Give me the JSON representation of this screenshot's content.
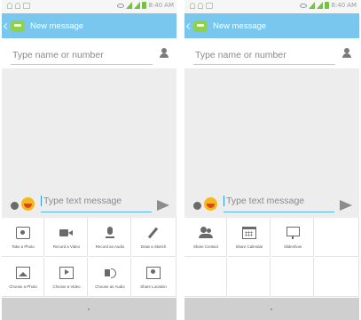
{
  "screens": [
    {
      "status": {
        "time": "8:40",
        "ampm": "AM"
      },
      "action_bar": {
        "title": "New message"
      },
      "recipient": {
        "placeholder": "Type name or number"
      },
      "compose": {
        "placeholder": "Type text message"
      },
      "attachments": [
        {
          "label": "Take a Photo",
          "icon": "camera-icon"
        },
        {
          "label": "Record a Video",
          "icon": "video-camera-icon"
        },
        {
          "label": "Record an Audio",
          "icon": "microphone-icon"
        },
        {
          "label": "Draw a Sketch",
          "icon": "pencil-icon"
        },
        {
          "label": "Choose a Photo",
          "icon": "image-icon"
        },
        {
          "label": "Choose a Video",
          "icon": "play-icon"
        },
        {
          "label": "Choose an Audio",
          "icon": "speaker-icon"
        },
        {
          "label": "Share Location",
          "icon": "map-icon"
        }
      ]
    },
    {
      "status": {
        "time": "8:40",
        "ampm": "AM"
      },
      "action_bar": {
        "title": "New message"
      },
      "recipient": {
        "placeholder": "Type name or number"
      },
      "compose": {
        "placeholder": "Type text message"
      },
      "attachments": [
        {
          "label": "Share Contact",
          "icon": "contacts-icon"
        },
        {
          "label": "Share Calendar",
          "icon": "calendar-icon"
        },
        {
          "label": "Slideshow",
          "icon": "slideshow-icon"
        }
      ]
    }
  ],
  "colors": {
    "action_bar": "#79c6ee",
    "accent": "#2d9ad8",
    "signal": "#76c043"
  }
}
